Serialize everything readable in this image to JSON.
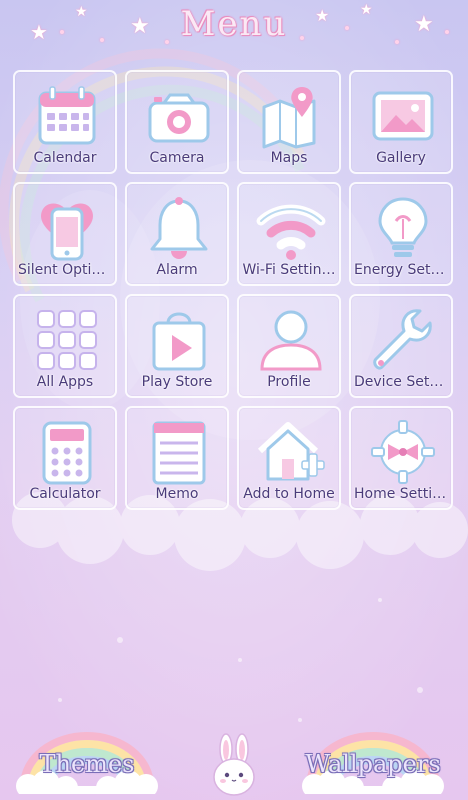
{
  "header": {
    "title": "Menu"
  },
  "tiles": [
    {
      "label": "Calendar",
      "icon": "calendar-icon"
    },
    {
      "label": "Camera",
      "icon": "camera-icon"
    },
    {
      "label": "Maps",
      "icon": "map-pin-icon"
    },
    {
      "label": "Gallery",
      "icon": "image-icon"
    },
    {
      "label": "Silent Optio…",
      "icon": "phone-heart-icon"
    },
    {
      "label": "Alarm",
      "icon": "bell-icon"
    },
    {
      "label": "Wi-Fi Settin…",
      "icon": "wifi-icon"
    },
    {
      "label": "Energy Setti…",
      "icon": "lightbulb-icon"
    },
    {
      "label": "All Apps",
      "icon": "apps-grid-icon"
    },
    {
      "label": "Play Store",
      "icon": "play-store-bag-icon"
    },
    {
      "label": "Profile",
      "icon": "person-icon"
    },
    {
      "label": "Device Setti…",
      "icon": "wrench-icon"
    },
    {
      "label": "Calculator",
      "icon": "calculator-icon"
    },
    {
      "label": "Memo",
      "icon": "memo-icon"
    },
    {
      "label": "Add to Home",
      "icon": "house-plus-icon"
    },
    {
      "label": "Home Settin…",
      "icon": "gear-bow-icon"
    }
  ],
  "footer": {
    "themes_label": "Themes",
    "wallpapers_label": "Wallpapers",
    "mascot_icon": "bunny-icon"
  },
  "colors": {
    "label_text": "#4a3b7a",
    "icon_pink": "#f29ac8",
    "icon_blue": "#9ec9ea",
    "icon_fill": "#ffffff",
    "title_glow": "#e98fc0"
  }
}
